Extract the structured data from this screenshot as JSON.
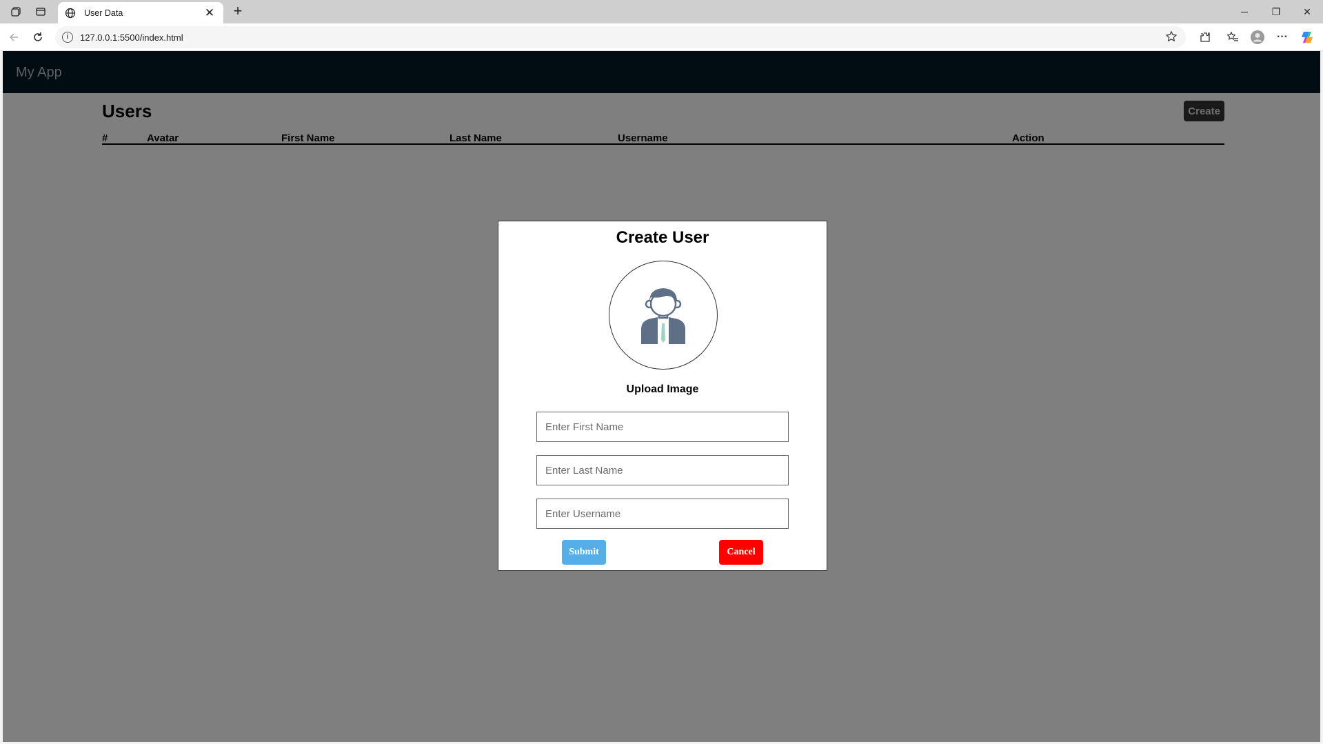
{
  "browser": {
    "tab_title": "User Data",
    "tab_close": "✕",
    "new_tab": "+",
    "url": "127.0.0.1:5500/index.html",
    "window_controls": {
      "minimize": "─",
      "restore": "❐",
      "close": "✕"
    },
    "more_menu": "···"
  },
  "app": {
    "brand": "My App",
    "page_title": "Users",
    "create_label": "Create",
    "table_headers": [
      "#",
      "Avatar",
      "First Name",
      "Last Name",
      "Username",
      "Action"
    ]
  },
  "modal": {
    "title": "Create User",
    "upload_label": "Upload Image",
    "first_name": {
      "placeholder": "Enter First Name",
      "value": ""
    },
    "last_name": {
      "placeholder": "Enter Last Name",
      "value": ""
    },
    "username": {
      "placeholder": "Enter Username",
      "value": ""
    },
    "submit_label": "Submit",
    "cancel_label": "Cancel"
  },
  "colors": {
    "navbar": "#021826",
    "submit": "#56aee8",
    "cancel": "#ff0000",
    "overlay": "rgba(0,0,0,0.5)"
  }
}
